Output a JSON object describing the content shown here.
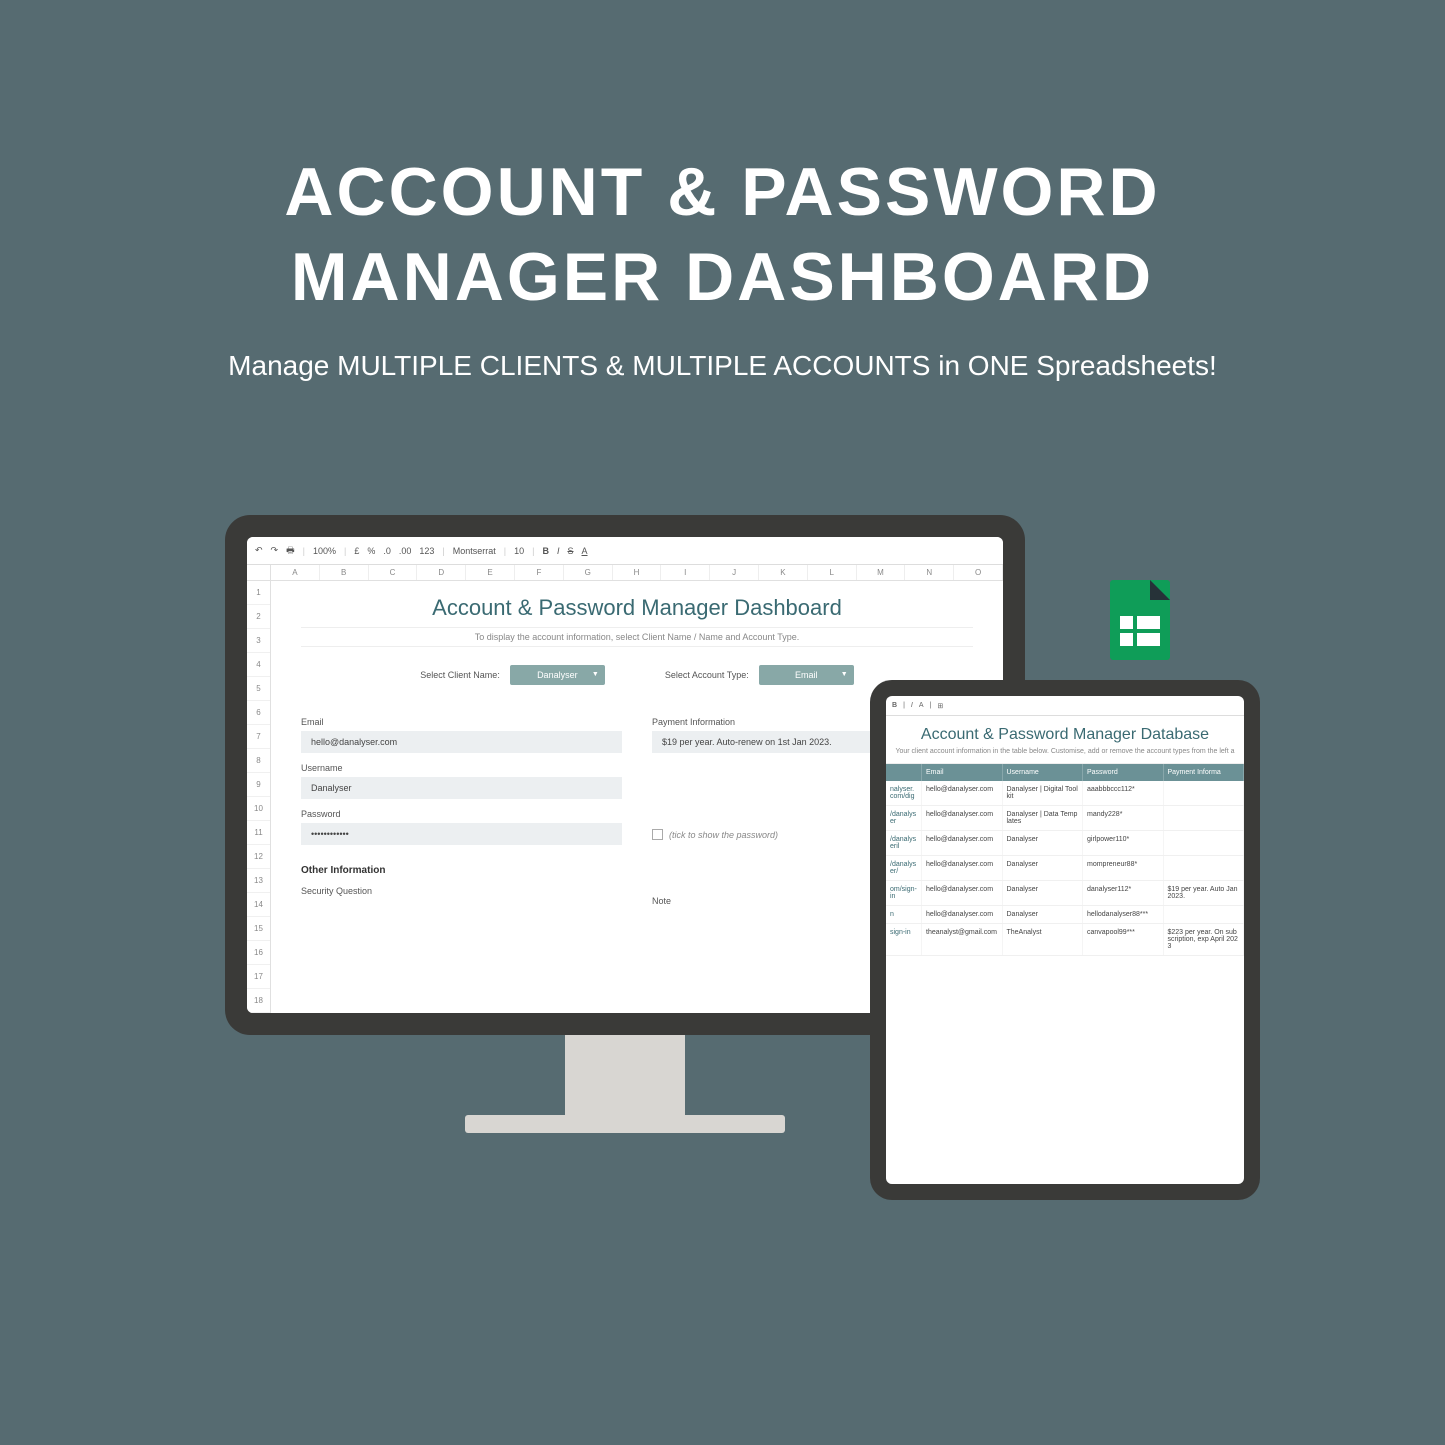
{
  "hero": {
    "title_line1": "ACCOUNT & PASSWORD",
    "title_line2": "MANAGER DASHBOARD",
    "subtitle": "Manage MULTIPLE CLIENTS & MULTIPLE ACCOUNTS in ONE Spreadsheets!"
  },
  "toolbar": {
    "undo": "↶",
    "redo": "↷",
    "print": "🖶",
    "zoom": "100%",
    "currency": "£",
    "percent": "%",
    "dec1": ".0",
    "dec2": ".00",
    "num": "123",
    "font": "Montserrat",
    "size": "10",
    "bold": "B",
    "italic": "I",
    "strike": "S",
    "underline": "A"
  },
  "columns": [
    "A",
    "B",
    "C",
    "D",
    "E",
    "F",
    "G",
    "H",
    "I",
    "J",
    "K",
    "L",
    "M",
    "N",
    "O"
  ],
  "rows": [
    "1",
    "2",
    "3",
    "4",
    "5",
    "6",
    "7",
    "8",
    "9",
    "10",
    "11",
    "12",
    "13",
    "14",
    "15",
    "16",
    "17",
    "18"
  ],
  "dashboard": {
    "title": "Account & Password Manager Dashboard",
    "subtitle": "To display the account information, select Client Name / Name and Account Type.",
    "client_label": "Select Client Name:",
    "client_value": "Danalyser",
    "account_label": "Select Account Type:",
    "account_value": "Email",
    "email_label": "Email",
    "email_value": "hello@danalyser.com",
    "username_label": "Username",
    "username_value": "Danalyser",
    "password_label": "Password",
    "password_value": "••••••••••••",
    "show_pw": "(tick to show the password)",
    "payment_label": "Payment Information",
    "payment_value": "$19 per year. Auto-renew on 1st Jan 2023.",
    "other_info": "Other Information",
    "security_q": "Security Question",
    "note": "Note"
  },
  "tablet_tb": {
    "bold": "B",
    "italic": "I",
    "underline": "A",
    "merge": "⊞"
  },
  "database": {
    "title": "Account & Password Manager Database",
    "subtitle": "Your client account information in the table below. Customise, add or remove the account types from the left a",
    "headers": [
      "Email",
      "Username",
      "Password",
      "Payment Informa"
    ],
    "rows": [
      {
        "link": "nalyser.com/dig",
        "email": "hello@danalyser.com",
        "user": "Danalyser | Digital Toolkit",
        "pw": "aaabbbccc112*",
        "pay": ""
      },
      {
        "link": "/danalyser",
        "email": "hello@danalyser.com",
        "user": "Danalyser | Data Templates",
        "pw": "mandy228*",
        "pay": ""
      },
      {
        "link": "/danalyseril",
        "email": "hello@danalyser.com",
        "user": "Danalyser",
        "pw": "girlpower110*",
        "pay": ""
      },
      {
        "link": "/danalyser/",
        "email": "hello@danalyser.com",
        "user": "Danalyser",
        "pw": "mompreneur88*",
        "pay": ""
      },
      {
        "link": "om/sign-in",
        "email": "hello@danalyser.com",
        "user": "Danalyser",
        "pw": "danalyser112*",
        "pay": "$19 per year. Auto Jan 2023."
      },
      {
        "link": "n",
        "email": "hello@danalyser.com",
        "user": "Danalyser",
        "pw": "hellodanalyser88***",
        "pay": ""
      },
      {
        "link": "sign-in",
        "email": "theanalyst@gmail.com",
        "user": "TheAnalyst",
        "pw": "canvapool99***",
        "pay": "$223 per year. On subscription, exp April 2023"
      }
    ]
  }
}
